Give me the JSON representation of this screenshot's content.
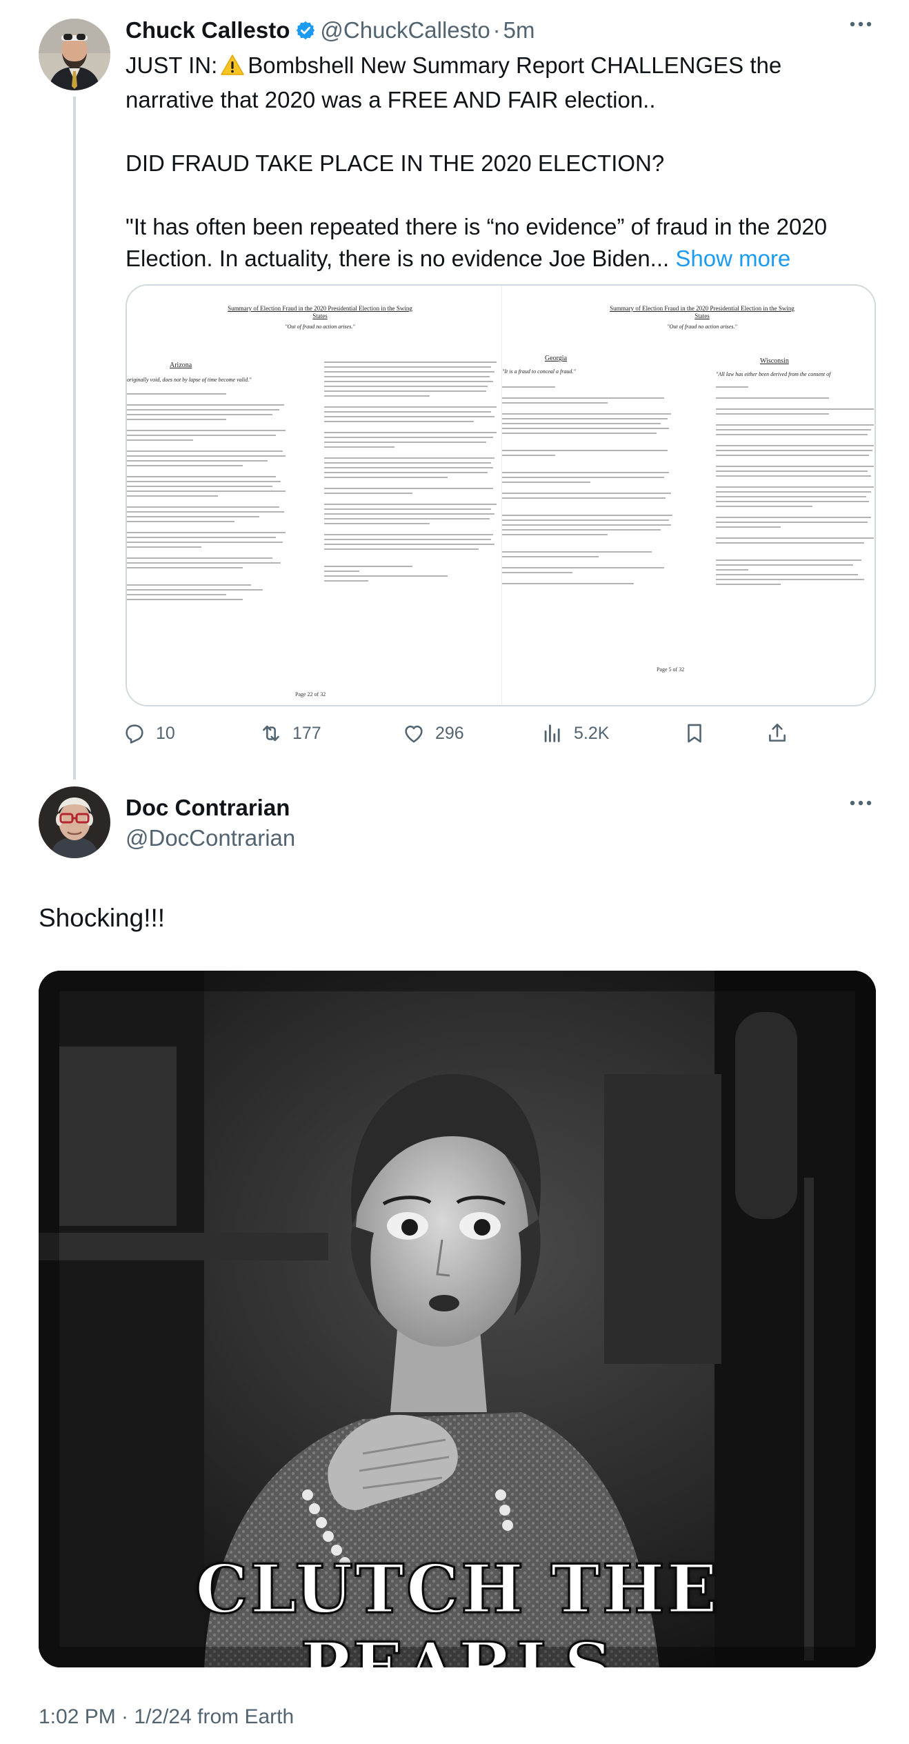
{
  "tweet": {
    "author_name": "Chuck Callesto",
    "verified_icon": "verified-badge-icon",
    "handle": "@ChuckCallesto",
    "separator": "·",
    "time": "5m",
    "avatar_icon": "user-avatar",
    "line1_a": "JUST IN:",
    "warning_icon": "warning-emoji",
    "line1_b": "Bombshell New Summary Report CHALLENGES the",
    "line2": "narrative that 2020 was a FREE AND FAIR election..",
    "para2": "DID FRAUD TAKE PLACE IN THE 2020 ELECTION?",
    "para3_line1": "\"It has often been repeated there is “no evidence” of fraud in the 2020",
    "para3_line2": "Election. In actuality, there is no evidence Joe Biden...",
    "show_more": "Show more",
    "media": {
      "left_page": {
        "title": "Summary of Election Fraud in the 2020 Presidential Election in the Swing States",
        "subtitle": "\"Out of fraud no action arises.\"",
        "state_left": "Arizona",
        "quote": "originally void, does not by lapse of time become valid.\"",
        "page_no": "Page 22 of 32"
      },
      "right_page": {
        "title": "Summary of Election Fraud in the 2020 Presidential Election in the Swing States",
        "subtitle": "\"Out of fraud no action arises.\"",
        "state_left": "Georgia",
        "quote_left": "\"It is a fraud to conceal a fraud.\"",
        "state_right": "Wisconsin",
        "quote_right": "\"All law has either been derived from the consent of",
        "page_no": "Page 5 of 32"
      }
    },
    "actions": {
      "replies": "10",
      "retweets": "177",
      "likes": "296",
      "views": "5.2K"
    }
  },
  "reply": {
    "author_name": "Doc Contrarian",
    "handle": "@DocContrarian",
    "text": "Shocking!!!",
    "gif_caption": "CLUTCH THE PEARLS",
    "timestamp": "1:02 PM · 1/2/24 from Earth"
  }
}
